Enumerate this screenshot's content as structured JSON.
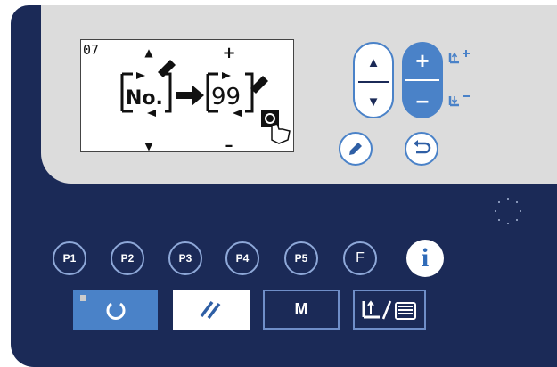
{
  "panel": {
    "lcd": {
      "pattern_number": "07",
      "source_label": "No.",
      "target_value": "99",
      "arrow_up": "▲",
      "arrow_down": "▼",
      "plus": "+",
      "minus": "–"
    },
    "nav_buttons": {
      "up": "▲",
      "down": "▼",
      "plus": "+",
      "minus": "–"
    },
    "p_buttons": [
      "P1",
      "P2",
      "P3",
      "P4",
      "P5"
    ],
    "f_button": "F",
    "info_button": "i",
    "m_button": "M",
    "colors": {
      "panel": "#1b2a57",
      "upper": "#dcdcdc",
      "accent": "#4a82c8",
      "white": "#ffffff"
    }
  }
}
